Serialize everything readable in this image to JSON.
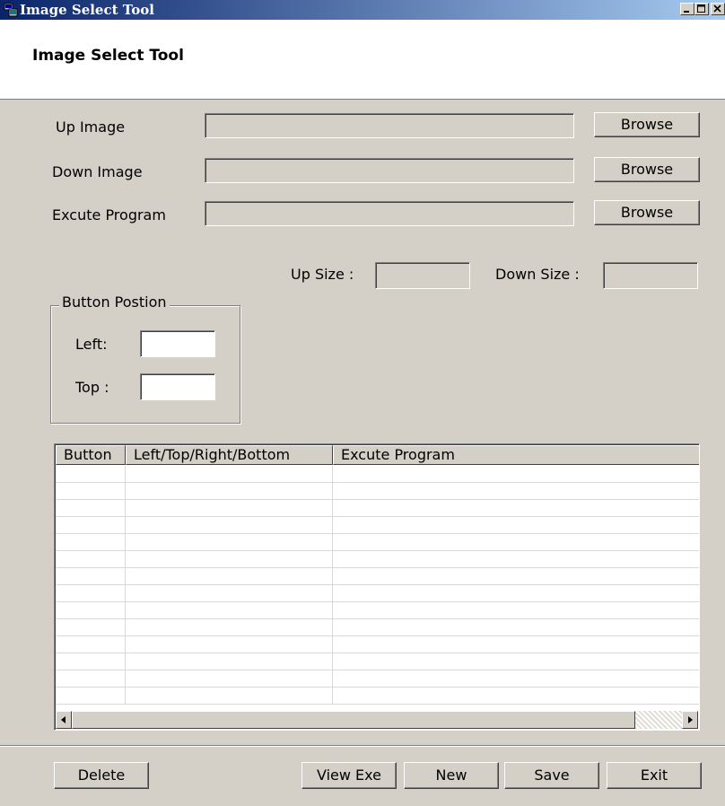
{
  "window": {
    "title": "Image Select Tool",
    "colors": {
      "face": "#d4d0c8",
      "title_start": "#0a246a",
      "title_end": "#a6caf0"
    }
  },
  "header": {
    "title": "Image Select Tool"
  },
  "fields": {
    "up_image": {
      "label": "Up Image",
      "value": "",
      "browse": "Browse"
    },
    "down_image": {
      "label": "Down Image",
      "value": "",
      "browse": "Browse"
    },
    "execute": {
      "label": "Excute Program",
      "value": "",
      "browse": "Browse"
    }
  },
  "sizes": {
    "up_label": "Up Size :",
    "up_value": "",
    "down_label": "Down Size :",
    "down_value": ""
  },
  "position_group": {
    "label": "Button Postion",
    "left_label": "Left:",
    "left_value": "",
    "top_label": "Top :",
    "top_value": ""
  },
  "table": {
    "columns": [
      "Button",
      "Left/Top/Right/Bottom",
      "Excute Program"
    ],
    "rows": []
  },
  "buttons": {
    "delete": "Delete",
    "view_exe": "View Exe",
    "new": "New",
    "save": "Save",
    "exit": "Exit"
  }
}
